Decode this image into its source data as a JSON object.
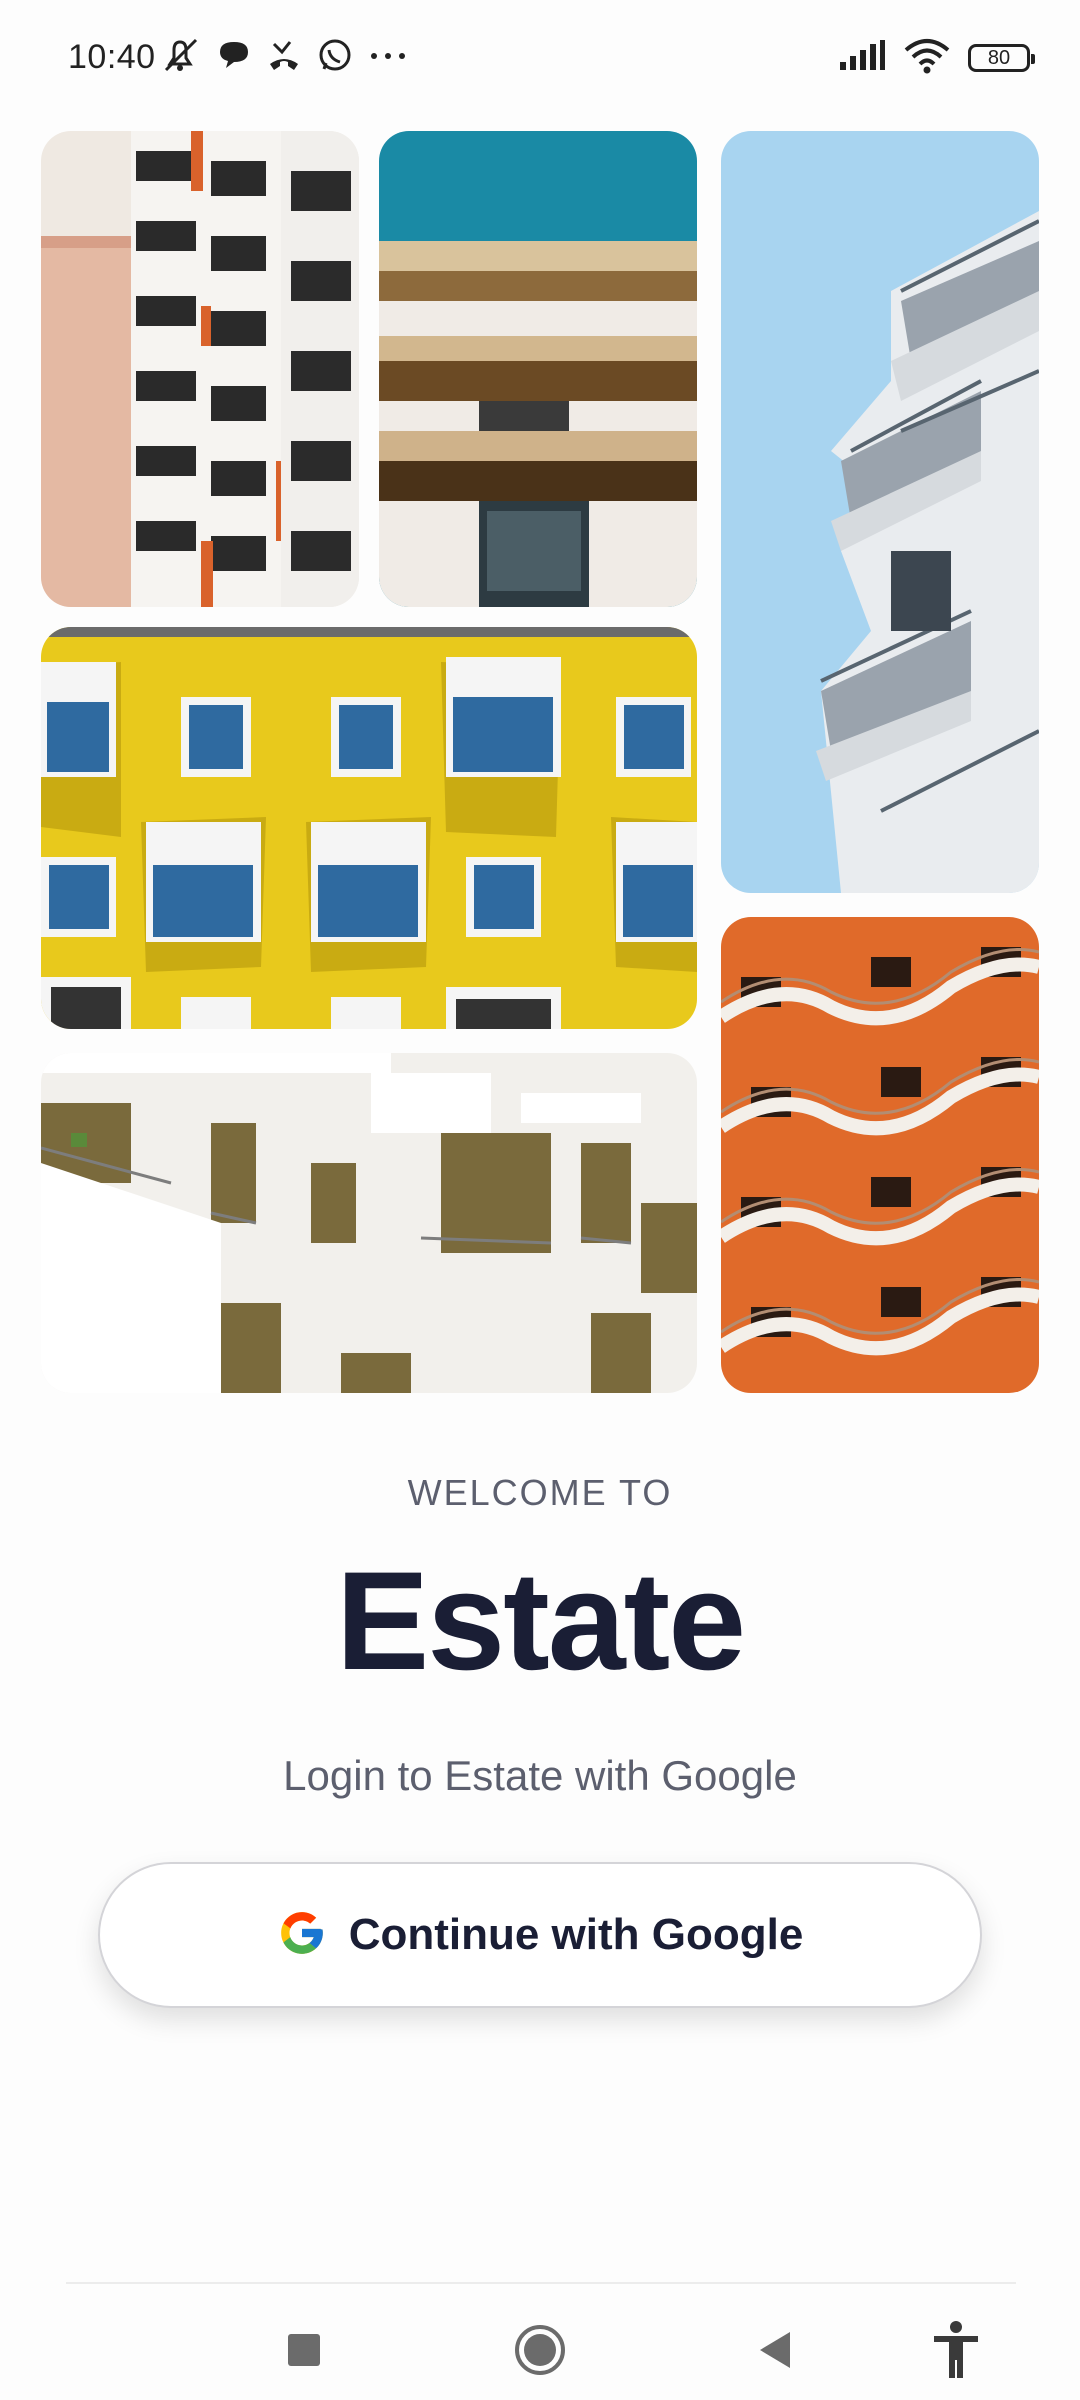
{
  "status_bar": {
    "time": "10:40",
    "left_icons": [
      "mute-icon",
      "chat-bubble-icon",
      "missed-call-icon",
      "whatsapp-icon",
      "more-dots-icon"
    ],
    "right_icons": [
      "signal-icon",
      "wifi-icon",
      "battery-icon"
    ],
    "battery_level": "80"
  },
  "gallery": {
    "tiles": [
      {
        "name": "building-photo-1",
        "description": "white and orange balcony building"
      },
      {
        "name": "building-photo-2",
        "description": "concrete balconies under teal sky"
      },
      {
        "name": "building-photo-3",
        "description": "glass balconies against blue sky"
      },
      {
        "name": "building-photo-4",
        "description": "yellow facade with bay windows"
      },
      {
        "name": "building-photo-5",
        "description": "orange wavy balconies"
      },
      {
        "name": "building-photo-6",
        "description": "white modern building with terraces"
      }
    ]
  },
  "welcome": {
    "kicker": "WELCOME TO",
    "app_name": "Estate",
    "subtitle": "Login to Estate with Google",
    "google_button_label": "Continue with Google"
  },
  "nav_bar": {
    "buttons": [
      "recents-square-icon",
      "home-circle-icon",
      "back-triangle-icon",
      "accessibility-icon"
    ]
  },
  "colors": {
    "title": "#1a1e35",
    "subtitle": "#5c5f6e",
    "yellow": "#e8c91c",
    "orange": "#e06a2a",
    "sky": "#a8d4f0",
    "teal": "#1a8aa5"
  }
}
